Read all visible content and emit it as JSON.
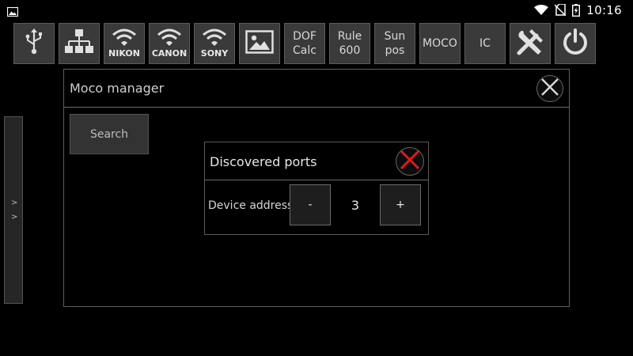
{
  "status_bar": {
    "time": "10:16",
    "icons": [
      "image-icon",
      "wifi-icon",
      "no-sim-icon",
      "battery-charging-icon"
    ]
  },
  "toolbar": {
    "items": [
      {
        "id": "usb",
        "icon": "usb-icon"
      },
      {
        "id": "network",
        "icon": "network-tree-icon"
      },
      {
        "id": "nikon",
        "icon": "wifi-icon",
        "label": "NIKON"
      },
      {
        "id": "canon",
        "icon": "wifi-icon",
        "label": "CANON"
      },
      {
        "id": "sony",
        "icon": "wifi-icon",
        "label": "SONY"
      },
      {
        "id": "image",
        "icon": "image-icon"
      },
      {
        "id": "dof",
        "label": "DOF\nCalc"
      },
      {
        "id": "rule600",
        "label": "Rule\n600"
      },
      {
        "id": "sunpos",
        "label": "Sun\npos"
      },
      {
        "id": "moco",
        "label": "MOCO"
      },
      {
        "id": "ic",
        "label": "IC"
      },
      {
        "id": "tools",
        "icon": "tools-icon"
      },
      {
        "id": "power",
        "icon": "power-icon"
      }
    ]
  },
  "side_handle": {
    "arrows": [
      ">",
      ">"
    ]
  },
  "moco_dialog": {
    "title": "Moco manager",
    "search_label": "Search"
  },
  "ports_dialog": {
    "title": "Discovered ports",
    "device_address_label": "Device address",
    "minus_label": "-",
    "value": "3",
    "plus_label": "+"
  },
  "colors": {
    "accent_close": "#e01b1b",
    "button_bg": "#3a3a3a"
  }
}
